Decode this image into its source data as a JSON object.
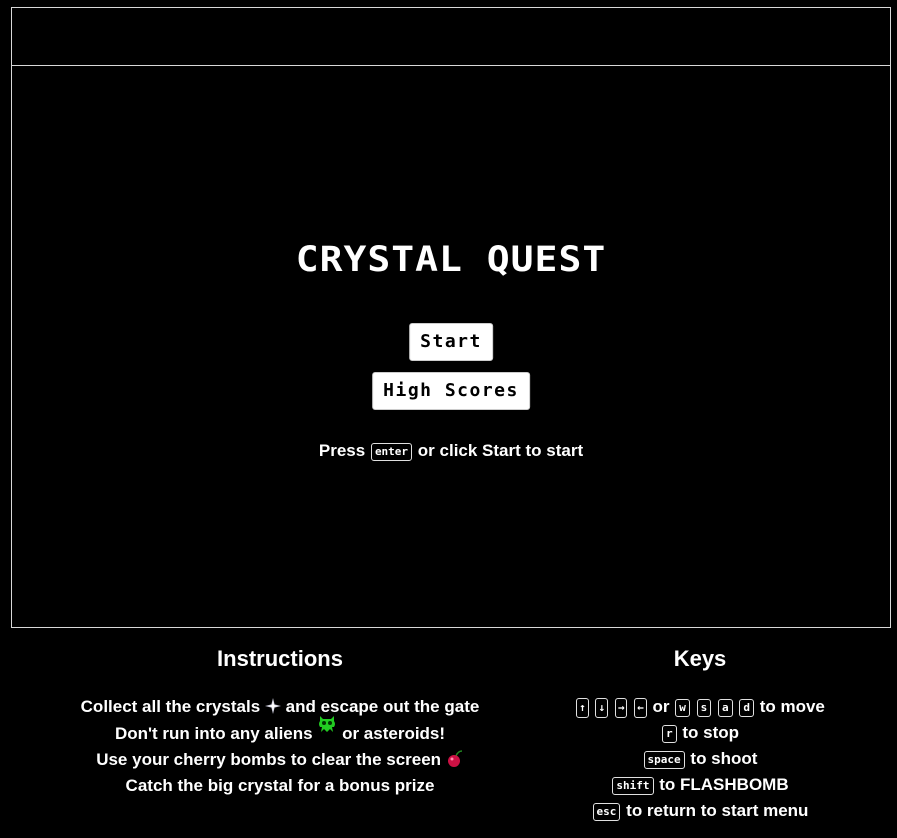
{
  "game": {
    "title": "CRYSTAL QUEST",
    "start_label": "Start",
    "high_scores_label": "High Scores",
    "press_prefix": "Press",
    "press_key": "enter",
    "press_suffix": "or click Start to start"
  },
  "instructions": {
    "heading": "Instructions",
    "line1_a": "Collect all the crystals",
    "line1_b": "and escape out the gate",
    "line2_a": "Don't run into any aliens",
    "line2_b": "or asteroids!",
    "line3_a": "Use your cherry bombs to clear the screen",
    "line4": "Catch the big crystal for a bonus prize"
  },
  "keys": {
    "heading": "Keys",
    "arrows": [
      "↑",
      "↓",
      "→",
      "←"
    ],
    "or_label": "or",
    "wasd": [
      "w",
      "s",
      "a",
      "d"
    ],
    "move_label": "to move",
    "stop_key": "r",
    "stop_label": "to stop",
    "shoot_key": "space",
    "shoot_label": "to shoot",
    "flash_key": "shift",
    "flash_label": "to FLASHBOMB",
    "esc_key": "esc",
    "esc_label": "to return to start menu"
  },
  "colors": {
    "background": "#000000",
    "text": "#ffffff",
    "border": "#d8d8d8",
    "alien": "#22cc22",
    "cherry": "#cc1144"
  },
  "icons": {
    "crystal": "crystal-sparkle-icon",
    "alien": "alien-icon",
    "cherry": "cherry-bomb-icon"
  }
}
